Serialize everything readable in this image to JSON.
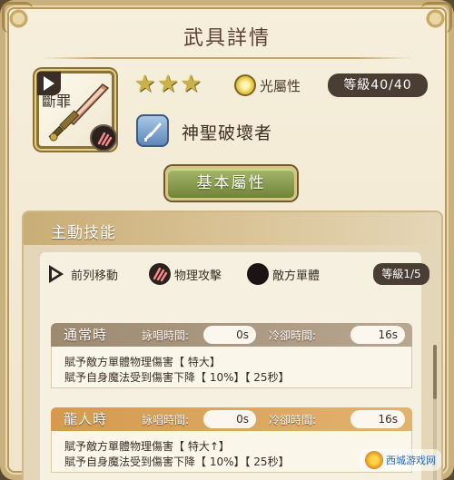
{
  "window": {
    "title": "武具詳情"
  },
  "weapon": {
    "stars": [
      "★",
      "★",
      "★"
    ],
    "attribute_label": "光屬性",
    "level_label": "等級40/40",
    "name": "神聖破壞者"
  },
  "base_button": {
    "label": "基本屬性"
  },
  "skill": {
    "section_label": "主動技能",
    "chips": [
      {
        "icon": "play-arrow-icon",
        "label": "前列移動"
      },
      {
        "icon": "claw-icon",
        "label": "物理攻擊"
      },
      {
        "icon": "target-dot-icon",
        "label": "敵方單體"
      }
    ],
    "level_label": "等級1/5",
    "name": "斷罪",
    "blocks": [
      {
        "title": "通常時",
        "cast_label": "詠唱時間:",
        "cast_value": "0s",
        "cd_label": "冷卻時間:",
        "cd_value": "16s",
        "lines": [
          "賦予敵方單體物理傷害【 特大】",
          "賦予自身魔法受到傷害下降【 10%】【 25秒】"
        ]
      },
      {
        "title": "龍人時",
        "cast_label": "詠唱時間:",
        "cast_value": "0s",
        "cd_label": "冷卻時間:",
        "cd_value": "16s",
        "lines": [
          "賦予敵方單體物理傷害【 特大↑】",
          "賦予自身魔法受到傷害下降【 10%】【 25秒】"
        ]
      }
    ]
  },
  "watermark": {
    "text": "西城游戏网"
  },
  "colors": {
    "panel_bg": "#f6efdc",
    "dark_pill": "#4a3d33",
    "button_green": "#7f9444",
    "dragon_orange": "#d59a4e"
  }
}
